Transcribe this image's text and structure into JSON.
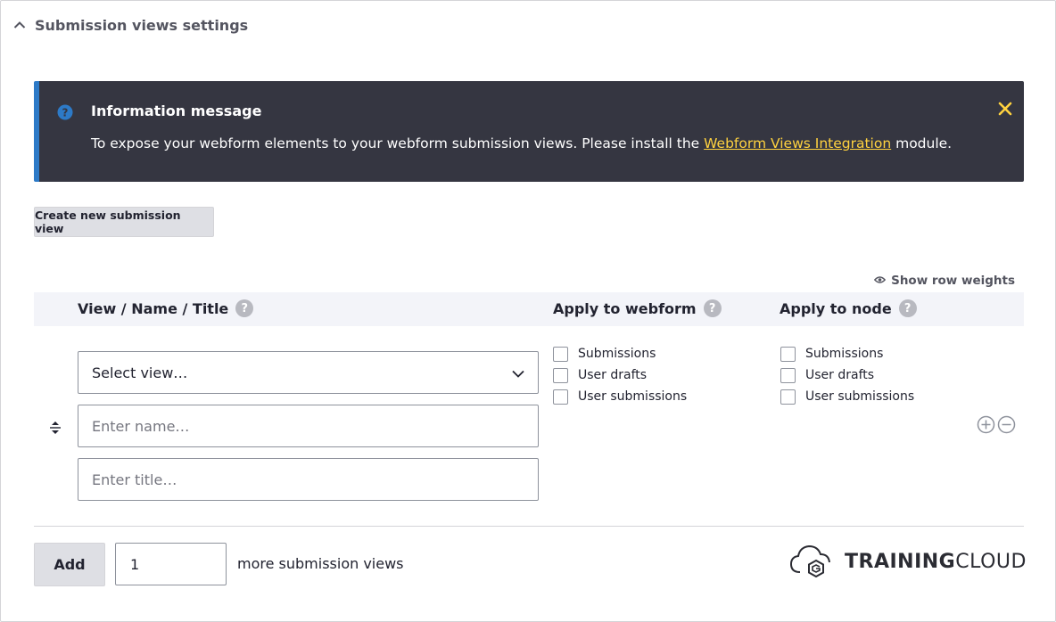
{
  "details": {
    "summary": "Submission views settings"
  },
  "message": {
    "title": "Information message",
    "text_before": "To expose your webform elements to your webform submission views. Please install the ",
    "link_text": "Webform Views Integration",
    "text_after": " module.",
    "close_icon": "close-icon",
    "accent_color": "#2d7ac7",
    "link_color": "#ffd23f",
    "close_color": "#ffd23f"
  },
  "create_button": "Create new submission view",
  "show_row_weights": "Show row weights",
  "table": {
    "col_view": "View / Name / Title",
    "col_webform": "Apply to webform",
    "col_node": "Apply to node",
    "help_glyph": "?",
    "row": {
      "select_value": "Select view…",
      "name_placeholder": "Enter name…",
      "title_placeholder": "Enter title…",
      "webform_options": [
        "Submissions",
        "User drafts",
        "User submissions"
      ],
      "node_options": [
        "Submissions",
        "User drafts",
        "User submissions"
      ]
    }
  },
  "footer": {
    "add_label": "Add",
    "count_value": "1",
    "more_label": "more submission views"
  },
  "logo": {
    "part1": "TRAINING",
    "part2": "CLOUD"
  }
}
